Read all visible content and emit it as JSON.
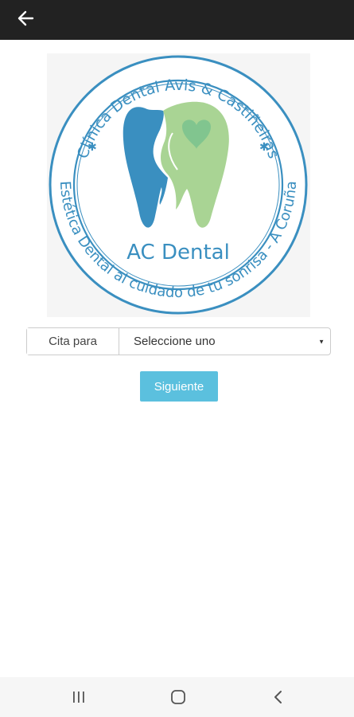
{
  "app_bar": {
    "back_icon": "arrow-left-icon",
    "background": "#222222"
  },
  "logo": {
    "ring_text_top": "Clínica Dental Avis & Castiñeiras",
    "ring_text_bottom": "Estética Dental al cuidado de tu sonrisa - A Coruña",
    "brand_name": "AC Dental",
    "colors": {
      "blue": "#3a8fc0",
      "green": "#a9d494",
      "light_green": "#c7e2b3"
    }
  },
  "form": {
    "label": "Cita para",
    "select_value": "Seleccione uno",
    "next_label": "Siguiente",
    "button_color": "#5bc0de"
  },
  "system_nav": {
    "recents_icon": "recents-icon",
    "home_icon": "home-icon",
    "back_icon": "system-back-icon"
  }
}
